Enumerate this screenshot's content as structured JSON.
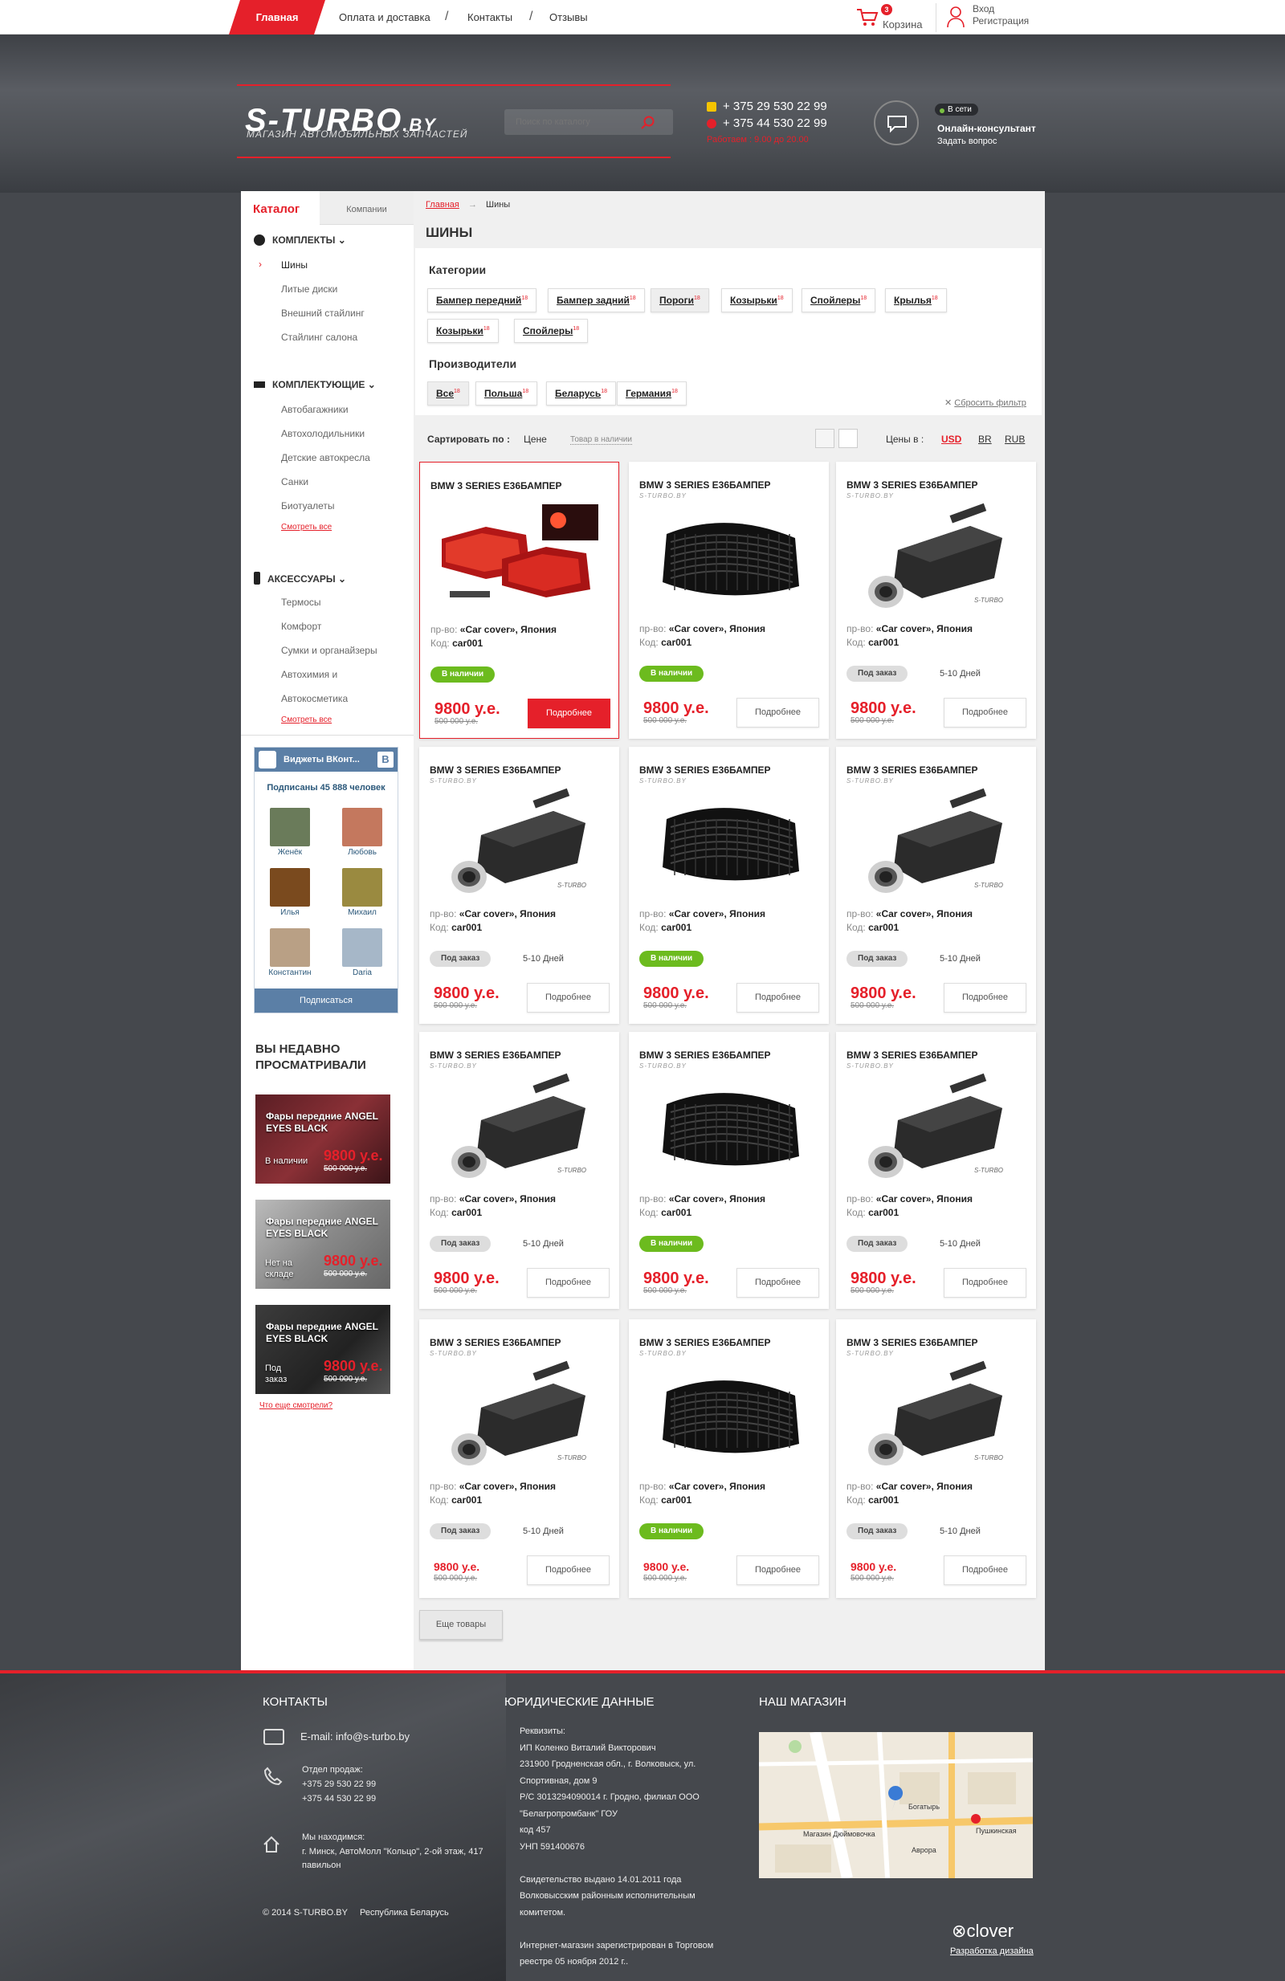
{
  "topnav": {
    "home": "Главная",
    "links": [
      "Оплата и доставка",
      "Контакты",
      "Отзывы"
    ]
  },
  "cart": {
    "count": "3",
    "label": "Корзина"
  },
  "login": {
    "login": "Вход",
    "register": "Регистрация"
  },
  "header": {
    "logo_main": "S-TURBO",
    "logo_suffix": ".BY",
    "logo_sub": "МАГАЗИН АВТОМОБИЛЬНЫХ ЗАПЧАСТЕЙ",
    "search_placeholder": "Поиск по каталогу",
    "phone1": "+ 375 29 530 22 99",
    "phone2": "+ 375 44 530 22 99",
    "hours": "Работаем : 9.00 до 20.00",
    "online": "В сети",
    "consult": "Онлайн-консультант",
    "ask": "Задать вопрос"
  },
  "sidebar": {
    "tab_catalog": "Каталог",
    "tab_companies": "Компании",
    "groups": [
      {
        "title": "КОМПЛЕКТЫ",
        "items": [
          "Шины",
          "Литые диски",
          "Внешний стайлинг",
          "Стайлинг салона"
        ]
      },
      {
        "title": "КОМПЛЕКТУЮЩИЕ",
        "items": [
          "Автобагажники",
          "Автохолодильники",
          "Детские автокресла",
          "Санки",
          "Биотуалеты"
        ],
        "more": "Смотреть все"
      },
      {
        "title": "АКСЕССУАРЫ",
        "items": [
          "Термосы",
          "Комфорт",
          "Сумки и органайзеры",
          "Автохимия и",
          "Автокосметика"
        ],
        "more": "Смотреть все"
      }
    ]
  },
  "vk": {
    "title": "Виджеты ВКонт...",
    "b": "B",
    "subs": "Подписаны 45 888 человек",
    "people": [
      "Женёк",
      "Любовь",
      "Илья",
      "Михаил",
      "Константин",
      "Daria"
    ],
    "button": "Подписаться"
  },
  "recent": {
    "title": "ВЫ НЕДАВНО ПРОСМАТРИВАЛИ",
    "items": [
      {
        "title": "Фары передние ANGEL EYES BLACK",
        "status": "В наличии",
        "price": "9800 у.е.",
        "old": "500 000 у.е."
      },
      {
        "title": "Фары передние ANGEL EYES BLACK",
        "status": "Нет на складе",
        "price": "9800 у.е.",
        "old": "500 000 у.е."
      },
      {
        "title": "Фары передние ANGEL EYES BLACK",
        "status": "Под заказ",
        "price": "9800 у.е.",
        "old": "500 000 у.е."
      }
    ],
    "more": "Что еще смотрели?"
  },
  "content": {
    "crumb_home": "Главная",
    "crumb_current": "Шины",
    "title": "ШИНЫ",
    "categories_title": "Категории",
    "categories": [
      {
        "label": "Бампер передний",
        "n": "18"
      },
      {
        "label": "Бампер задний",
        "n": "18"
      },
      {
        "label": "Пороги",
        "n": "18"
      },
      {
        "label": "Козырьки",
        "n": "18"
      },
      {
        "label": "Спойлеры",
        "n": "18"
      },
      {
        "label": "Крылья",
        "n": "18"
      },
      {
        "label": "Козырьки",
        "n": "18"
      },
      {
        "label": "Спойлеры",
        "n": "18"
      }
    ],
    "makers_title": "Производители",
    "makers": [
      {
        "label": "Все",
        "n": "18"
      },
      {
        "label": "Польша",
        "n": "18"
      },
      {
        "label": "Беларусь",
        "n": "18"
      },
      {
        "label": "Германия",
        "n": "18"
      }
    ],
    "reset": "Сбросить фильтр",
    "sort_label": "Сартировать по :",
    "sort_price": "Цене",
    "sort_stock": "Товар в наличии",
    "prices_in": "Цены в :",
    "currencies": [
      "USD",
      "BR",
      "RUB"
    ],
    "load_more": "Еще товары"
  },
  "card_common": {
    "title": "BMW 3 SERIES E36БАМПЕР",
    "brand": "S-TURBO.BY",
    "maker_label": "пр-во:",
    "maker": "«Car cover», Япония",
    "code_label": "Код:",
    "code": "car001",
    "price": "9800 у.е.",
    "old": "500 000 у.е.",
    "more": "Подробнее",
    "in": "В наличии",
    "order": "Под заказ",
    "days": "5-10 Дней"
  },
  "products": [
    {
      "img": "lights",
      "status": "in"
    },
    {
      "img": "grille",
      "status": "in"
    },
    {
      "img": "muffler",
      "status": "order"
    },
    {
      "img": "muffler",
      "status": "order"
    },
    {
      "img": "grille",
      "status": "in"
    },
    {
      "img": "muffler",
      "status": "order"
    },
    {
      "img": "muffler",
      "status": "order"
    },
    {
      "img": "grille",
      "status": "in"
    },
    {
      "img": "muffler",
      "status": "order"
    },
    {
      "img": "muffler",
      "status": "order"
    },
    {
      "img": "grille",
      "status": "in"
    },
    {
      "img": "muffler",
      "status": "order"
    }
  ],
  "footer": {
    "contacts_title": "КОНТАКТЫ",
    "email": "E-mail: info@s-turbo.by",
    "sales_title": "Отдел продаж:",
    "sales_phone1": "+375 29 530 22 99",
    "sales_phone2": "+375 44 530 22 99",
    "address_title": "Мы находимся:",
    "address": "г. Минск, АвтоМолл \"Кольцо\", 2-ой этаж, 417 павильон",
    "copyright": "© 2014 S-TURBO.BY",
    "country": "Республика Беларусь",
    "legal_title": "ЮРИДИЧЕСКИЕ ДАННЫЕ",
    "legal_lines": [
      "Реквизиты:",
      "ИП Коленко Виталий Викторович",
      "231900 Гродненская обл., г. Волковыск, ул.",
      "Спортивная, дом 9",
      "Р/С 3013294090014 г. Гродно, филиал ООО",
      "\"Белагропромбанк\" ГОУ",
      "код 457",
      "УНП 591400676",
      "",
      "Свидетельство выдано 14.01.2011 года",
      "Волковысским районным исполнительным",
      "комитетом.",
      "",
      "Интернет-магазин зарегистрирован в Торговом",
      "реестре 05 ноября 2012 г.."
    ],
    "shop_title": "НАШ МАГАЗИН",
    "map_labels": [
      "Богатырь",
      "Магазин Дюймовочка",
      "Пушкинская",
      "Аврора"
    ],
    "clover": "clover",
    "clover_sub": "Разработка дизайна"
  },
  "colors": {
    "accent": "#e5202a",
    "in_stock": "#6cbb1e",
    "vk": "#5b7fa6"
  }
}
